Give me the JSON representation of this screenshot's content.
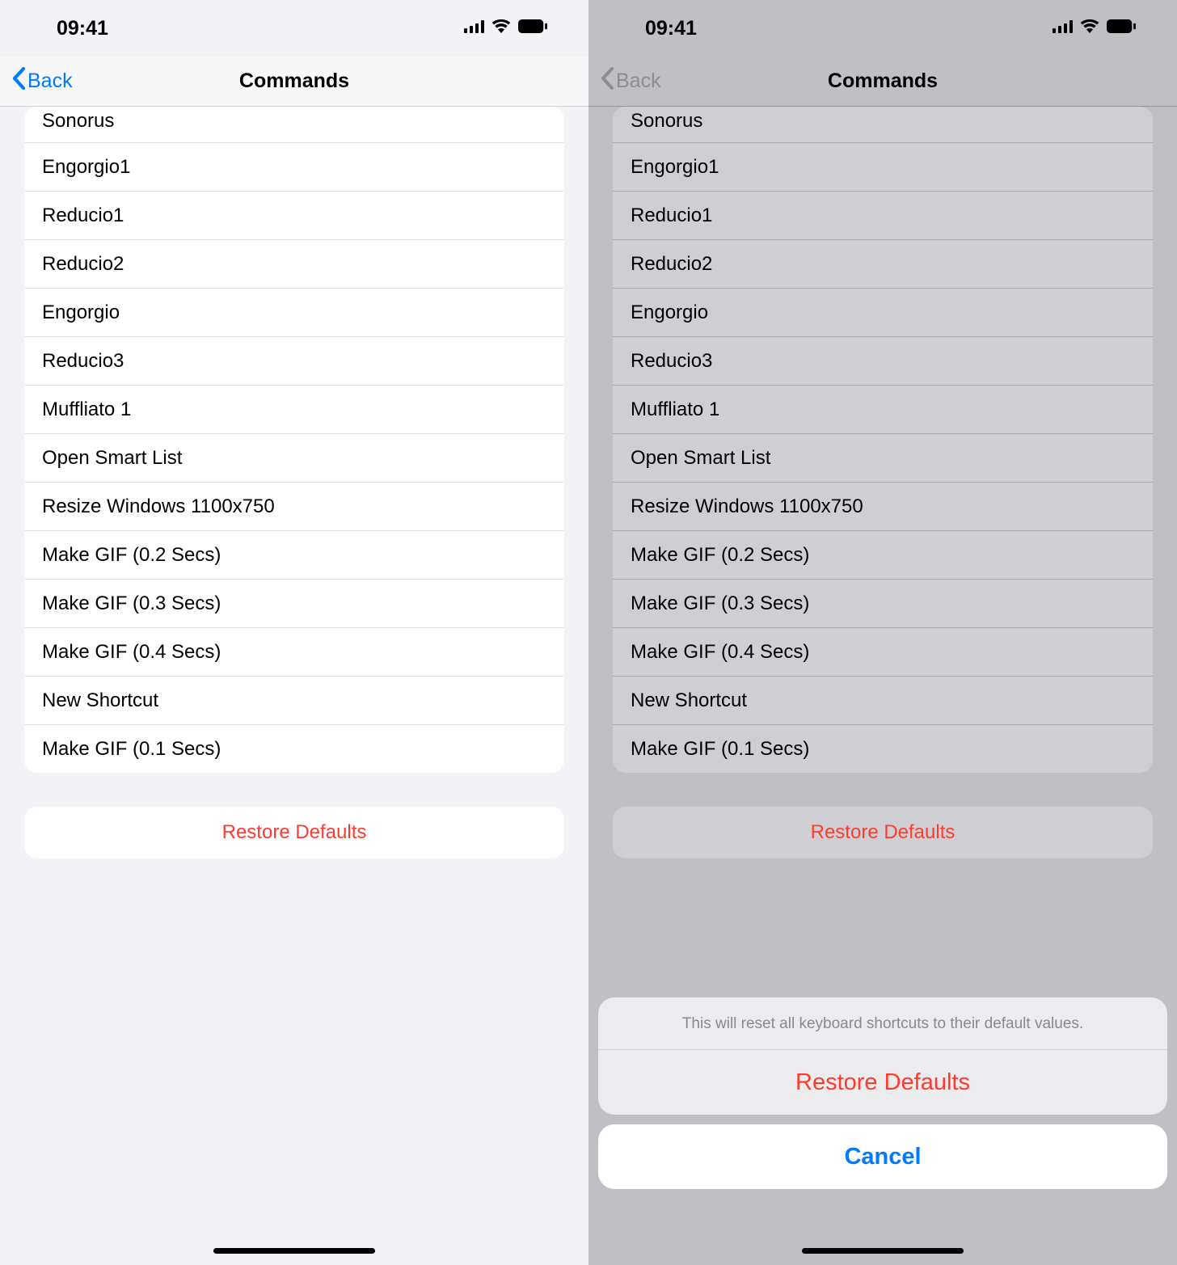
{
  "status": {
    "time": "09:41"
  },
  "nav": {
    "back": "Back",
    "title": "Commands"
  },
  "commands": [
    "Sonorus",
    "Engorgio1",
    "Reducio1",
    "Reducio2",
    "Engorgio",
    "Reducio3",
    "Muffliato 1",
    "Open Smart List",
    "Resize Windows 1100x750",
    "Make GIF (0.2 Secs)",
    "Make GIF (0.3 Secs)",
    "Make GIF (0.4 Secs)",
    "New Shortcut",
    "Make GIF (0.1 Secs)"
  ],
  "restore_label": "Restore Defaults",
  "sheet": {
    "message": "This will reset all keyboard shortcuts to their default values.",
    "destructive": "Restore Defaults",
    "cancel": "Cancel"
  },
  "colors": {
    "ios_blue": "#007aff",
    "ios_red": "#ff3b30",
    "page_bg": "#f2f2f7",
    "dim_bg": "#bfbfc4"
  }
}
